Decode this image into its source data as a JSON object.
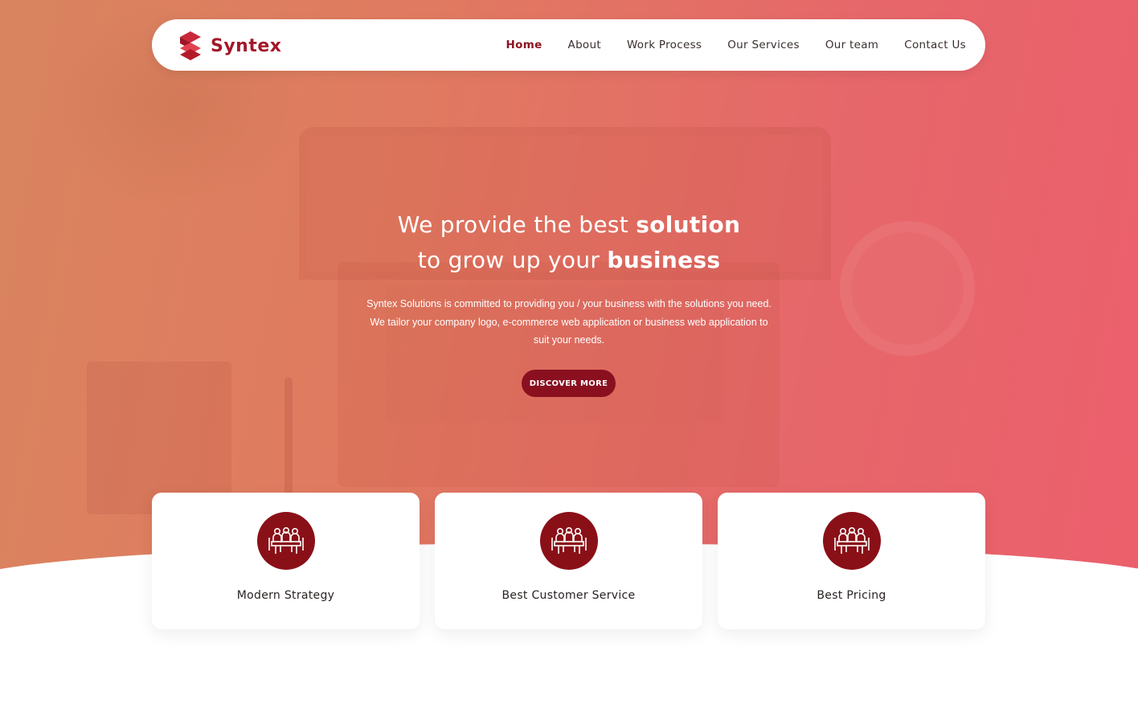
{
  "brand": {
    "name": "Syntex",
    "color": "#a3182a"
  },
  "nav": {
    "items": [
      {
        "label": "Home",
        "active": true
      },
      {
        "label": "About",
        "active": false
      },
      {
        "label": "Work Process",
        "active": false
      },
      {
        "label": "Our Services",
        "active": false
      },
      {
        "label": "Our team",
        "active": false
      },
      {
        "label": "Contact Us",
        "active": false
      }
    ]
  },
  "hero": {
    "title_line1_plain": "We provide the best ",
    "title_line1_bold": "solution",
    "title_line2_plain": "to grow up your ",
    "title_line2_bold": "business",
    "description_line1": "Syntex Solutions is committed to providing you / your business with the solutions you need.",
    "description_line2": "We tailor your company logo, e-commerce web application or business web application to",
    "description_line3": "suit your needs.",
    "cta_label": "DISCOVER MORE",
    "gradient_start": "#d9845f",
    "gradient_end": "#ec5f6c"
  },
  "features": [
    {
      "title": "Modern Strategy",
      "icon": "team-meeting-icon"
    },
    {
      "title": "Best Customer Service",
      "icon": "team-meeting-icon"
    },
    {
      "title": "Best Pricing",
      "icon": "team-meeting-icon"
    }
  ],
  "colors": {
    "accent": "#8a1020",
    "nav_active": "#8c1420"
  }
}
